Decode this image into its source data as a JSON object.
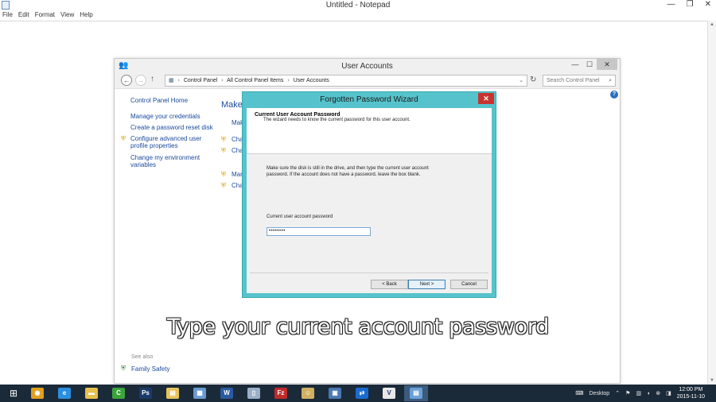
{
  "notepad": {
    "title": "Untitled - Notepad",
    "menu": [
      "File",
      "Edit",
      "Format",
      "View",
      "Help"
    ],
    "controls": {
      "minimize": "—",
      "restore": "❐",
      "close": "✕"
    }
  },
  "user_accounts": {
    "title": "User Accounts",
    "controls": {
      "minimize": "—",
      "maximize": "☐",
      "close": "✕"
    },
    "breadcrumb": [
      "Control Panel",
      "All Control Panel Items",
      "User Accounts"
    ],
    "search_placeholder": "Search Control Panel",
    "sidebar": {
      "home": "Control Panel Home",
      "links": [
        "Manage your credentials",
        "Create a password reset disk",
        "Configure advanced user profile properties",
        "Change my environment variables"
      ]
    },
    "see_also": "See also",
    "family_safety": "Family Safety",
    "main": {
      "heading": "Make c",
      "links": [
        "Mak",
        "Cha",
        "Cha",
        "Man",
        "Cha"
      ]
    }
  },
  "wizard": {
    "title": "Forgotten Password Wizard",
    "close": "✕",
    "header_title": "Current User Account Password",
    "header_subtitle": "The wizard needs to know the current password for this user account.",
    "instructions": "Make sure the disk is still in the drive, and then type the current user account password. If the account does not have a password, leave the box blank.",
    "field_label": "Current user account password",
    "field_value": "••••••••",
    "buttons": {
      "back": "< Back",
      "next": "Next >",
      "cancel": "Cancel"
    }
  },
  "caption": "Type your current account password",
  "taskbar": {
    "apps": [
      {
        "icon": "chrome-icon",
        "color": "#e0a020",
        "glyph": "◉"
      },
      {
        "icon": "ie-icon",
        "color": "#2a8fe0",
        "glyph": "e"
      },
      {
        "icon": "explorer-icon",
        "color": "#e8c04a",
        "glyph": "▬"
      },
      {
        "icon": "greenapp-icon",
        "color": "#3aa43a",
        "glyph": "C"
      },
      {
        "icon": "photoshop-icon",
        "color": "#1a3a6a",
        "glyph": "Ps"
      },
      {
        "icon": "folder-icon",
        "color": "#e6c45a",
        "glyph": "▤"
      },
      {
        "icon": "document-icon",
        "color": "#6a9ad0",
        "glyph": "▦"
      },
      {
        "icon": "word-icon",
        "color": "#2a5aa0",
        "glyph": "W"
      },
      {
        "icon": "file-icon",
        "color": "#9ab0c8",
        "glyph": "▯"
      },
      {
        "icon": "filezilla-icon",
        "color": "#c02a2a",
        "glyph": "Fz"
      },
      {
        "icon": "people-icon",
        "color": "#d0b060",
        "glyph": "☺"
      },
      {
        "icon": "network-icon",
        "color": "#4a78b0",
        "glyph": "▣"
      },
      {
        "icon": "teamviewer-icon",
        "color": "#1a6ad0",
        "glyph": "⇄"
      },
      {
        "icon": "vnc-icon",
        "color": "#e8e8e8",
        "glyph": "V"
      },
      {
        "icon": "control-panel-icon",
        "color": "#6aa0d8",
        "glyph": "▤"
      }
    ],
    "desktop_label": "Desktop",
    "time": "12:00 PM",
    "date": "2015-11-10"
  }
}
